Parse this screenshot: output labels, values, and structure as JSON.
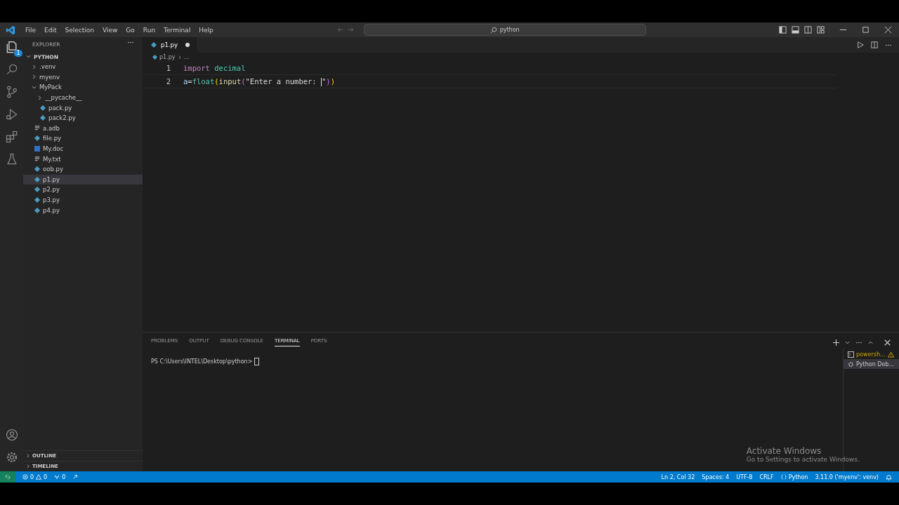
{
  "menu": [
    "File",
    "Edit",
    "Selection",
    "View",
    "Go",
    "Run",
    "Terminal",
    "Help"
  ],
  "command_center": {
    "value": "python"
  },
  "activity_bar": [
    {
      "kind": "explorer",
      "selected": true,
      "badge": "1"
    },
    {
      "kind": "search",
      "selected": false
    },
    {
      "kind": "source-control",
      "selected": false
    },
    {
      "kind": "run",
      "selected": false
    },
    {
      "kind": "extensions",
      "selected": false
    },
    {
      "kind": "testing",
      "selected": false
    }
  ],
  "sidebar": {
    "title": "EXPLORER",
    "root": "PYTHON",
    "items": [
      {
        "label": ".venv",
        "kind": "folder",
        "expanded": false,
        "selected": false
      },
      {
        "label": "myenv",
        "kind": "folder",
        "expanded": false,
        "selected": false
      },
      {
        "label": "MyPack",
        "kind": "folder",
        "expanded": true,
        "selected": false,
        "children": [
          {
            "label": "__pycache__",
            "kind": "folder",
            "expanded": false,
            "selected": false
          },
          {
            "label": "pack.py",
            "kind": "python",
            "selected": false
          },
          {
            "label": "pack2.py",
            "kind": "python",
            "selected": false
          }
        ]
      },
      {
        "label": "a.adb",
        "kind": "text",
        "selected": false
      },
      {
        "label": "file.py",
        "kind": "python",
        "selected": false
      },
      {
        "label": "My.doc",
        "kind": "word",
        "selected": false
      },
      {
        "label": "My.txt",
        "kind": "text",
        "selected": false
      },
      {
        "label": "oob.py",
        "kind": "python",
        "selected": false
      },
      {
        "label": "p1.py",
        "kind": "python",
        "selected": true
      },
      {
        "label": "p2.py",
        "kind": "python",
        "selected": false
      },
      {
        "label": "p3.py",
        "kind": "python",
        "selected": false
      },
      {
        "label": "p4.py",
        "kind": "python",
        "selected": false
      }
    ],
    "sections": [
      "OUTLINE",
      "TIMELINE"
    ]
  },
  "tabs": [
    {
      "label": "p1.py",
      "selected": true,
      "modified": true
    }
  ],
  "breadcrumb": [
    "p1.py",
    "..."
  ],
  "code": [
    {
      "number": "1",
      "tokens": [
        {
          "kind": "keyword",
          "text": "import"
        },
        {
          "kind": "module",
          "text": " decimal"
        }
      ]
    },
    {
      "number": "2",
      "tokens": [
        {
          "kind": "variable",
          "text": "a"
        },
        {
          "kind": "plain",
          "text": "="
        },
        {
          "kind": "module",
          "text": "float"
        },
        {
          "kind": "bracket1",
          "text": "("
        },
        {
          "kind": "function",
          "text": "input"
        },
        {
          "kind": "bracket2",
          "text": "("
        },
        {
          "kind": "string",
          "text": "\"Enter a number: "
        },
        {
          "kind": "cursor"
        },
        {
          "kind": "string",
          "text": "\""
        },
        {
          "kind": "bracket2",
          "text": ")"
        },
        {
          "kind": "bracket1",
          "text": ")"
        }
      ]
    }
  ],
  "panel": {
    "tabs": [
      {
        "label": "PROBLEMS",
        "selected": false
      },
      {
        "label": "OUTPUT",
        "selected": false
      },
      {
        "label": "DEBUG CONSOLE",
        "selected": false
      },
      {
        "label": "TERMINAL",
        "selected": true
      },
      {
        "label": "PORTS",
        "selected": false
      }
    ],
    "prompt": "PS C:\\Users\\INTEL\\Desktop\\python>",
    "terminals": [
      {
        "label": "powersh...",
        "kind": "shell",
        "warning": true,
        "selected": false
      },
      {
        "label": "Python Deb...",
        "kind": "debug",
        "warning": false,
        "selected": true
      }
    ]
  },
  "activation": {
    "title": "Activate Windows",
    "text": "Go to Settings to activate Windows."
  },
  "status_bar": {
    "errors": "0",
    "warnings": "0",
    "ports": "0",
    "right": [
      {
        "kind": "text",
        "text": "Ln 2, Col 32"
      },
      {
        "kind": "text",
        "text": "Spaces: 4"
      },
      {
        "kind": "text",
        "text": "UTF-8"
      },
      {
        "kind": "text",
        "text": "CRLF"
      },
      {
        "kind": "language",
        "text": "Python"
      },
      {
        "kind": "text",
        "text": "3.11.0 ('myenv': venv)"
      }
    ]
  }
}
